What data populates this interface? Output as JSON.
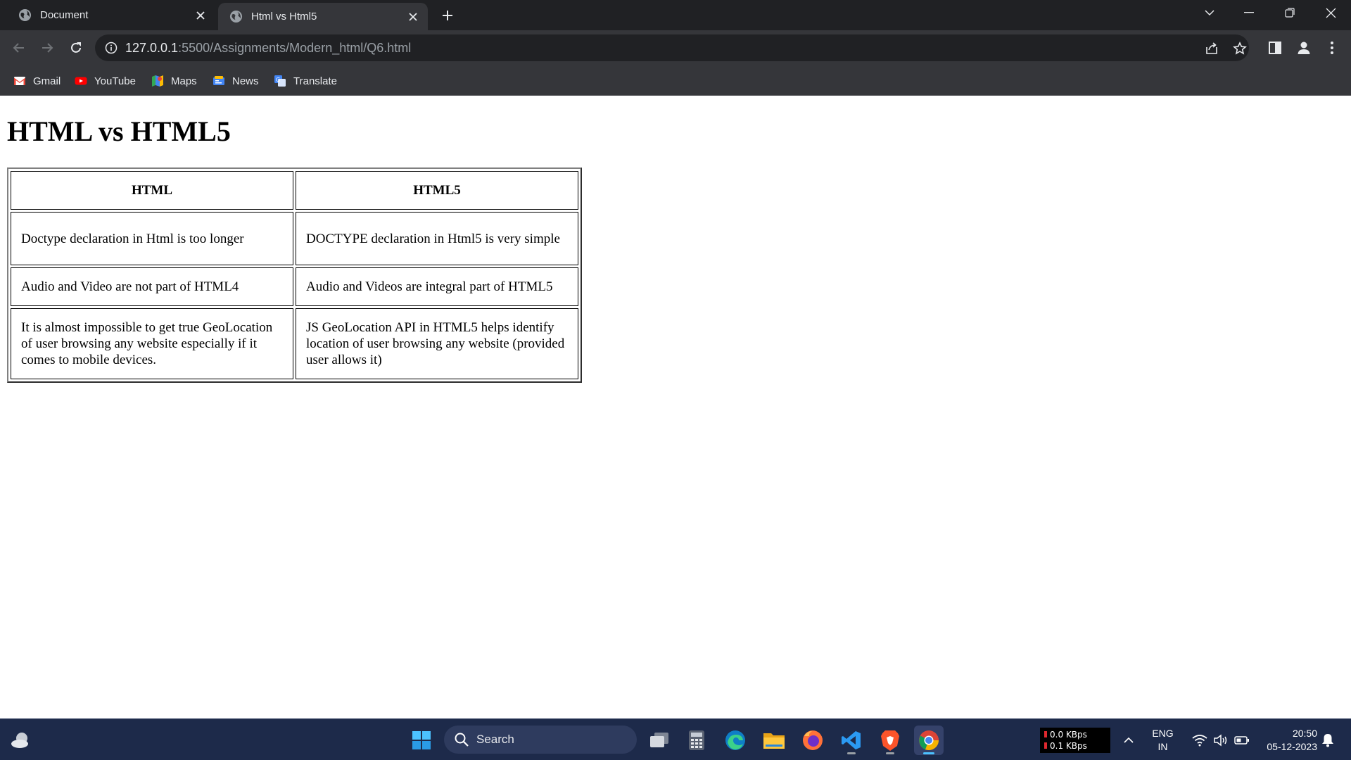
{
  "tabs": [
    {
      "title": "Document",
      "active": false
    },
    {
      "title": "Html vs Html5",
      "active": true
    }
  ],
  "address": {
    "host": "127.0.0.1",
    "path": ":5500/Assignments/Modern_html/Q6.html"
  },
  "bookmarks": [
    {
      "label": "Gmail",
      "icon": "gmail-icon"
    },
    {
      "label": "YouTube",
      "icon": "youtube-icon"
    },
    {
      "label": "Maps",
      "icon": "maps-icon"
    },
    {
      "label": "News",
      "icon": "news-icon"
    },
    {
      "label": "Translate",
      "icon": "translate-icon"
    }
  ],
  "page": {
    "heading": "HTML vs HTML5",
    "table": {
      "headers": [
        "HTML",
        "HTML5"
      ],
      "rows": [
        [
          "Doctype declaration in Html is too longer",
          "DOCTYPE declaration in Html5 is very simple"
        ],
        [
          "Audio and Video are not part of HTML4",
          "Audio and Videos are integral part of HTML5"
        ],
        [
          "It is almost impossible to get true GeoLocation of user browsing any website especially if it comes to mobile devices.",
          "JS GeoLocation API in HTML5 helps identify location of user browsing any website (provided user allows it)"
        ]
      ]
    }
  },
  "taskbar": {
    "search_label": "Search",
    "apps": [
      "task-view-icon",
      "calculator-icon",
      "edge-icon",
      "file-explorer-icon",
      "firefox-icon",
      "vscode-icon",
      "brave-icon",
      "chrome-icon"
    ],
    "net_up": "0.0 KBps",
    "net_down": "0.1 KBps",
    "lang_top": "ENG",
    "lang_bottom": "IN",
    "time": "20:50",
    "date": "05-12-2023"
  },
  "colors": {
    "tab_bg": "#202124",
    "toolbar_bg": "#35363a",
    "taskbar_bg": "#1d2a4a",
    "accent": "#4cc2ff"
  }
}
